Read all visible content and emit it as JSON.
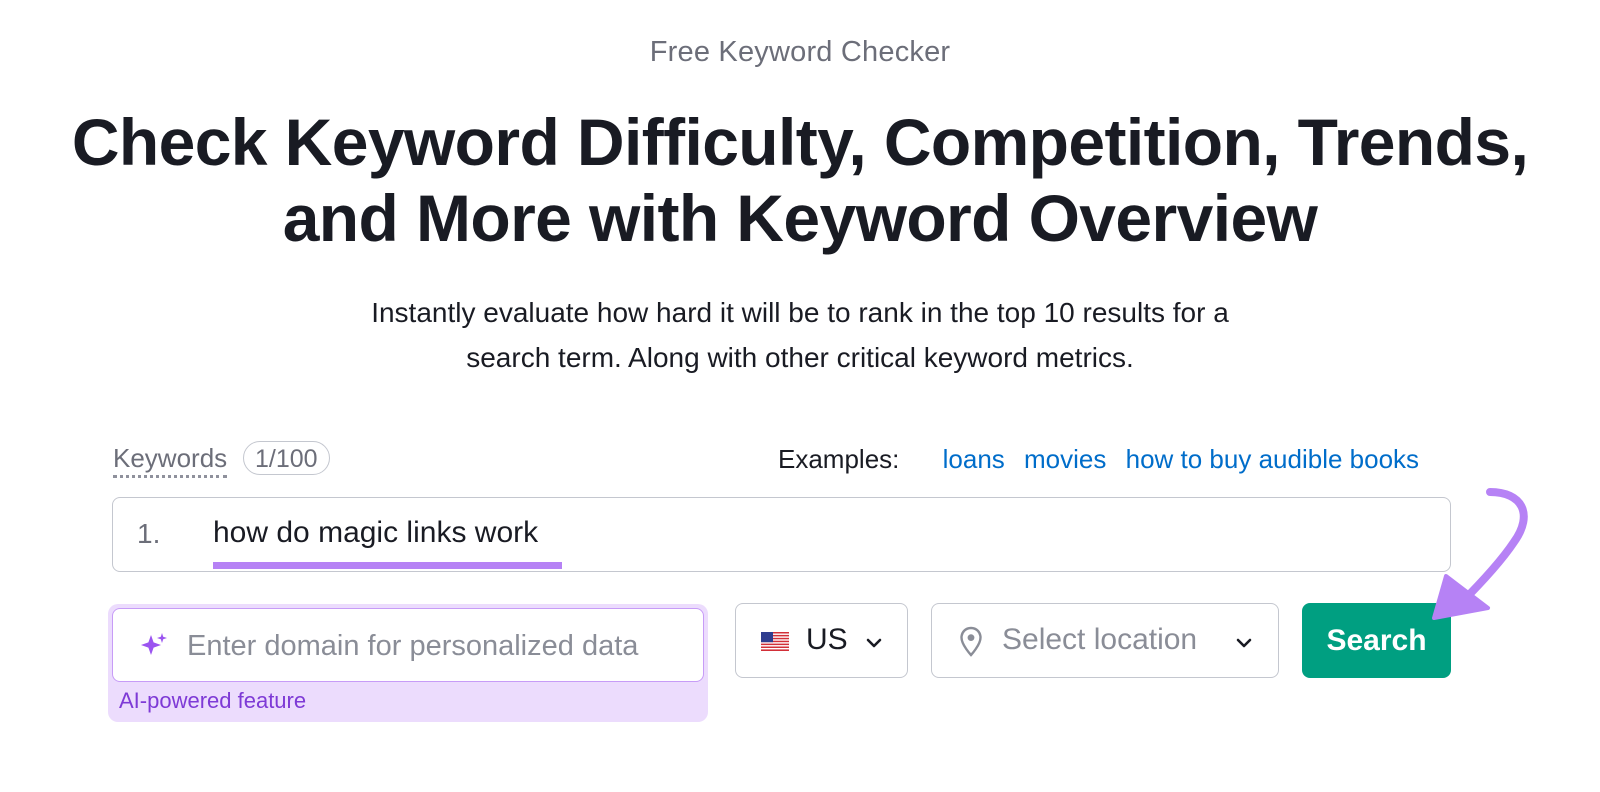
{
  "header": {
    "eyebrow": "Free Keyword Checker",
    "title_line1": "Check Keyword Difficulty, Competition, Trends,",
    "title_line2": "and More with Keyword Overview",
    "subtitle_line1": "Instantly evaluate how hard it will be to rank in the top 10 results for a",
    "subtitle_line2": "search term. Along with other critical keyword metrics."
  },
  "keywords": {
    "label": "Keywords",
    "count": "1/100",
    "examples_label": "Examples:",
    "examples": [
      "loans",
      "movies",
      "how to buy audible books"
    ],
    "entries": [
      {
        "number": "1.",
        "text": "how do magic links work"
      }
    ]
  },
  "domain_input": {
    "placeholder": "Enter domain for personalized data",
    "value": "",
    "icon": "sparkle-icon",
    "note": "AI-powered feature"
  },
  "country_select": {
    "value": "US",
    "icon": "us-flag-icon"
  },
  "location_select": {
    "placeholder": "Select location",
    "icon": "location-pin-icon"
  },
  "search_button": {
    "label": "Search"
  },
  "colors": {
    "accent_purple": "#b682f5",
    "ai_background": "#ecdcfd",
    "ai_text": "#7e3ad6",
    "link_blue": "#006dca",
    "search_green": "#009f81"
  }
}
